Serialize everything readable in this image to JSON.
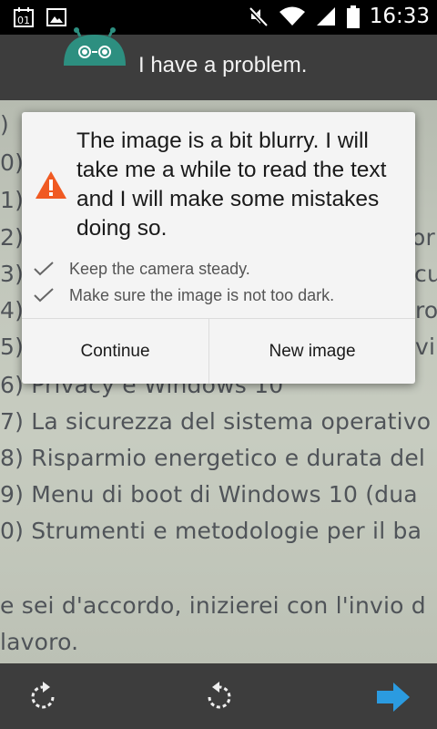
{
  "status_bar": {
    "calendar_day": "01",
    "time": "16:33",
    "icons": [
      "calendar-icon",
      "image-icon",
      "mute-icon",
      "wifi-icon",
      "signal-icon",
      "battery-icon"
    ]
  },
  "header": {
    "title": "I have a problem.",
    "icon": "robot-icon"
  },
  "dialog": {
    "message": "The image is a bit blurry. I will take me a while to read the text and I will make some mistakes doing so.",
    "tips": [
      "Keep the camera steady.",
      "Make sure the image is not too dark."
    ],
    "buttons": {
      "continue": "Continue",
      "new_image": "New image"
    },
    "warning_color": "#f05a22"
  },
  "photo_text": {
    "lines": [
      ")",
      "0)",
      "1)",
      "2)",
      "3)",
      "4)",
      "5)",
      "6) Privacy e Windows 10",
      "7) La sicurezza del sistema operativo",
      "8) Risparmio energetico e durata del",
      "9) Menu di boot di Windows 10 (dua",
      "0) Strumenti e metodologie per il ba",
      "e sei d'accordo, inizierei con l'invio d",
      "lavoro."
    ],
    "right_fragments": [
      "or",
      "cu",
      "ro",
      "vi"
    ]
  },
  "bottom_bar": {
    "icons": [
      "rotate-left-icon",
      "rotate-right-icon",
      "next-arrow-icon"
    ],
    "accent_color": "#2b9be0"
  }
}
